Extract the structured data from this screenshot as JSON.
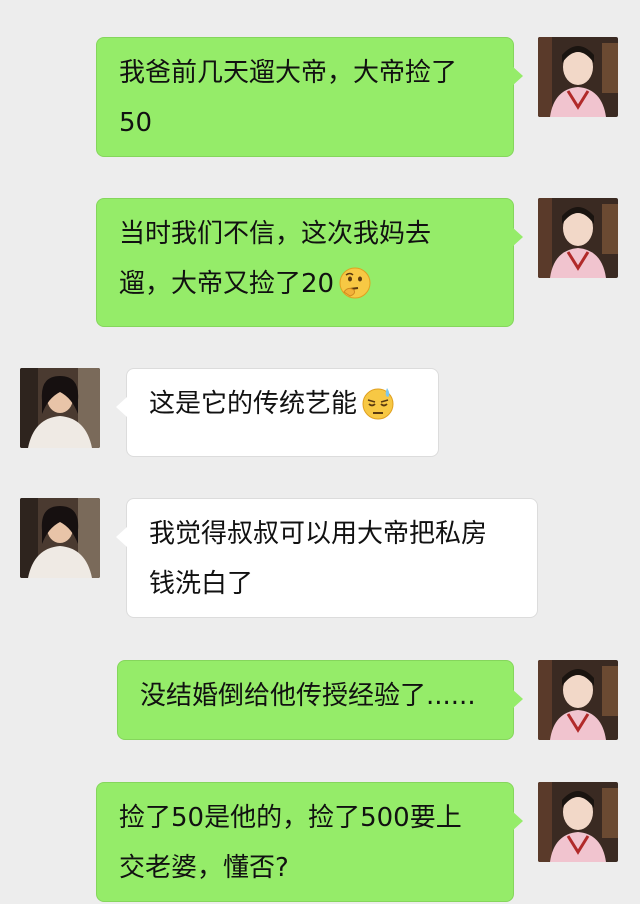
{
  "chat": {
    "messages": [
      {
        "side": "sent",
        "lines": [
          "我爸前几天遛大帝，大帝捡了",
          "50"
        ],
        "emoji": ""
      },
      {
        "side": "sent",
        "lines": [
          "当时我们不信，这次我妈去",
          "遛，大帝又捡了20"
        ],
        "emoji": "thinking-face-icon"
      },
      {
        "side": "recv",
        "lines": [
          "这是它的传统艺能"
        ],
        "emoji": "anxious-face-with-sweat-icon"
      },
      {
        "side": "recv",
        "lines": [
          "我觉得叔叔可以用大帝把私房",
          "钱洗白了"
        ],
        "emoji": ""
      },
      {
        "side": "sent",
        "lines": [
          "没结婚倒给他传授经验了......"
        ],
        "emoji": ""
      },
      {
        "side": "sent",
        "lines": [
          "捡了50是他的，捡了500要上",
          "交老婆，懂否?"
        ],
        "emoji": ""
      }
    ]
  },
  "colors": {
    "background": "#ededed",
    "sent_bubble": "#95ec69",
    "recv_bubble": "#ffffff"
  }
}
